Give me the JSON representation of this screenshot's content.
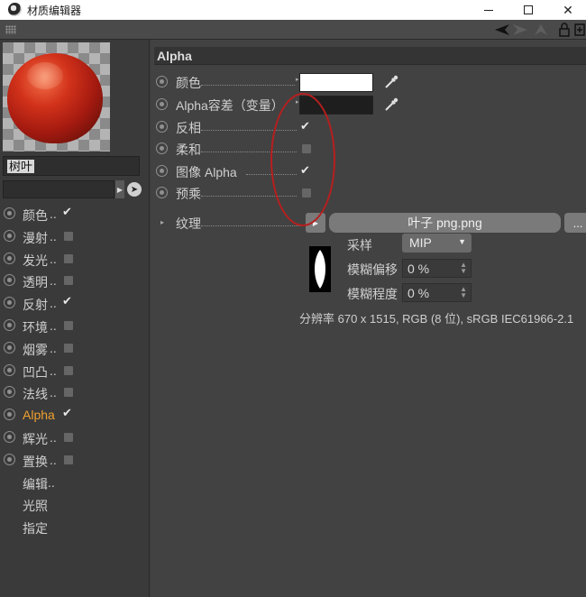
{
  "window": {
    "title": "材质编辑器"
  },
  "material": {
    "name": "树叶"
  },
  "channels": [
    {
      "label": "颜色",
      "dots": "..",
      "has_radio": true,
      "checked": true,
      "active": false
    },
    {
      "label": "漫射",
      "dots": "..",
      "has_radio": true,
      "checked": false,
      "active": false
    },
    {
      "label": "发光",
      "dots": "..",
      "has_radio": true,
      "checked": false,
      "active": false
    },
    {
      "label": "透明",
      "dots": "..",
      "has_radio": true,
      "checked": false,
      "active": false
    },
    {
      "label": "反射",
      "dots": "..",
      "has_radio": true,
      "checked": true,
      "active": false
    },
    {
      "label": "环境",
      "dots": "..",
      "has_radio": true,
      "checked": false,
      "active": false
    },
    {
      "label": "烟雾",
      "dots": "..",
      "has_radio": true,
      "checked": false,
      "active": false
    },
    {
      "label": "凹凸",
      "dots": "..",
      "has_radio": true,
      "checked": false,
      "active": false
    },
    {
      "label": "法线",
      "dots": "..",
      "has_radio": true,
      "checked": false,
      "active": false
    },
    {
      "label": "Alpha",
      "dots": "",
      "has_radio": true,
      "checked": true,
      "active": true
    },
    {
      "label": "辉光",
      "dots": "..",
      "has_radio": true,
      "checked": false,
      "active": false
    },
    {
      "label": "置换",
      "dots": "..",
      "has_radio": true,
      "checked": false,
      "active": false
    },
    {
      "label": "编辑",
      "dots": "..",
      "has_radio": false,
      "checked": null,
      "active": false
    },
    {
      "label": "光照",
      "dots": "",
      "has_radio": false,
      "checked": null,
      "active": false
    },
    {
      "label": "指定",
      "dots": "",
      "has_radio": false,
      "checked": null,
      "active": false
    }
  ],
  "alpha": {
    "header": "Alpha",
    "color_label": "颜色",
    "color_value": "#ffffff",
    "tolerance_label": "Alpha容差（变量）",
    "tolerance_value": "#1e1e1e",
    "invert_label": "反相",
    "invert_checked": true,
    "soft_label": "柔和",
    "soft_checked": false,
    "image_alpha_label": "图像 Alpha",
    "image_alpha_checked": true,
    "premultiply_label": "预乘",
    "premultiply_checked": false,
    "texture_label": "纹理",
    "texture_file": "叶子 png.png",
    "texture_more": "...",
    "sampling_label": "采样",
    "sampling_value": "MIP",
    "blur_offset_label": "模糊偏移",
    "blur_offset_value": "0 %",
    "blur_scale_label": "模糊程度",
    "blur_scale_value": "0 %",
    "resolution_info": "分辨率 670 x 1515, RGB (8 位), sRGB IEC61966-2.1"
  },
  "colors": {
    "accent_active": "#f0a030",
    "annotation": "#b81e1e"
  }
}
